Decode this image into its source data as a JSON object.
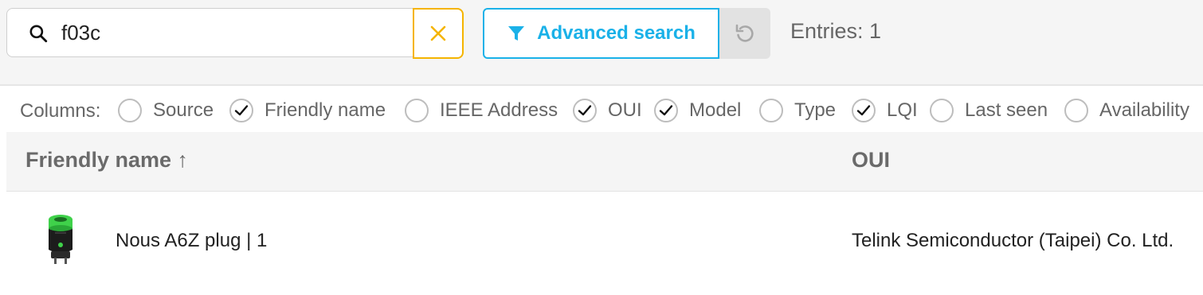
{
  "search": {
    "value": "f03c",
    "placeholder": ""
  },
  "toolbar": {
    "advanced_label": "Advanced search",
    "entries_text": "Entries: 1"
  },
  "columns": {
    "label": "Columns:",
    "options": [
      {
        "label": "Source",
        "checked": false
      },
      {
        "label": "Friendly name",
        "checked": true
      },
      {
        "label": "IEEE Address",
        "checked": false
      },
      {
        "label": "OUI",
        "checked": true
      },
      {
        "label": "Model",
        "checked": true
      },
      {
        "label": "Type",
        "checked": false
      },
      {
        "label": "LQI",
        "checked": true
      },
      {
        "label": "Last seen",
        "checked": false
      },
      {
        "label": "Availability",
        "checked": false
      }
    ]
  },
  "table": {
    "headers": {
      "friendly_name": "Friendly name ↑",
      "oui": "OUI"
    },
    "rows": [
      {
        "friendly_name": "Nous A6Z plug | 1",
        "oui": "Telink Semiconductor (Taipei) Co. Ltd.",
        "image_icon": "smart-plug-image"
      }
    ]
  },
  "colors": {
    "accent_blue": "#1ab1e8",
    "clear_yellow": "#f5b400",
    "plug_green": "#3fd14a"
  }
}
